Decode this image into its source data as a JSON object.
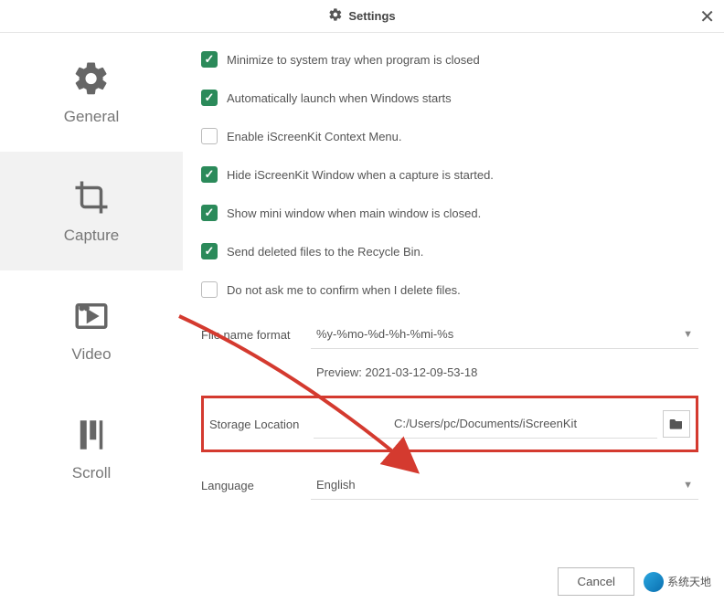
{
  "title": "Settings",
  "sidebar": {
    "items": [
      {
        "label": "General"
      },
      {
        "label": "Capture"
      },
      {
        "label": "Video"
      },
      {
        "label": "Scroll"
      }
    ]
  },
  "checks": {
    "minimize": {
      "label": "Minimize to system tray when program is closed",
      "checked": true
    },
    "autostart": {
      "label": "Automatically launch when Windows starts",
      "checked": true
    },
    "contextmenu": {
      "label": "Enable iScreenKit Context Menu.",
      "checked": false
    },
    "hidewin": {
      "label": "Hide iScreenKit Window when a capture is started.",
      "checked": true
    },
    "miniwin": {
      "label": "Show mini window when main window is closed.",
      "checked": true
    },
    "recycle": {
      "label": "Send deleted files to the Recycle Bin.",
      "checked": true
    },
    "noconfirm": {
      "label": "Do not ask me to confirm when I delete files.",
      "checked": false
    }
  },
  "filename": {
    "label": "File name format",
    "value": "%y-%mo-%d-%h-%mi-%s",
    "previewLabel": "Preview: 2021-03-12-09-53-18"
  },
  "storage": {
    "label": "Storage Location",
    "path": "C:/Users/pc/Documents/iScreenKit"
  },
  "language": {
    "label": "Language",
    "value": "English"
  },
  "buttons": {
    "cancel": "Cancel"
  },
  "watermark": "系统天地"
}
